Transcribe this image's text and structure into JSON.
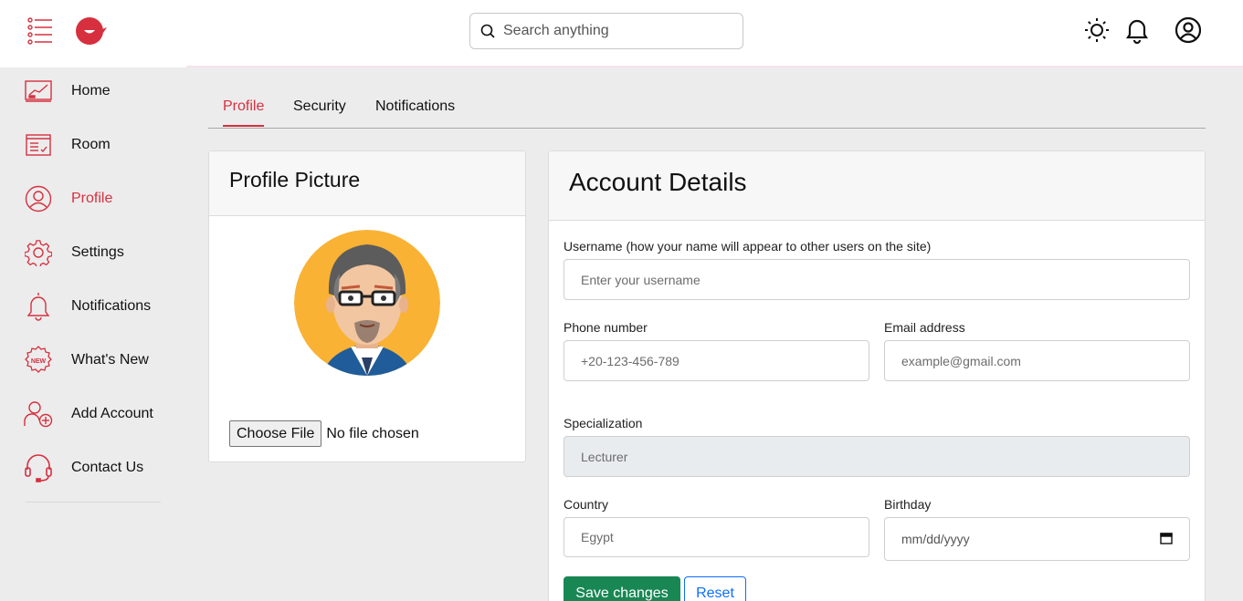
{
  "sidebar": {
    "items": [
      {
        "label": "Home",
        "icon": "chart-monitor-icon"
      },
      {
        "label": "Room",
        "icon": "checklist-board-icon"
      },
      {
        "label": "Profile",
        "icon": "user-circle-icon"
      },
      {
        "label": "Settings",
        "icon": "gear-icon"
      },
      {
        "label": "Notifications",
        "icon": "bell-icon"
      },
      {
        "label": "What's New",
        "icon": "new-badge-icon"
      },
      {
        "label": "Add Account",
        "icon": "add-user-icon"
      },
      {
        "label": "Contact Us",
        "icon": "headset-icon"
      }
    ],
    "active_index": 2
  },
  "search": {
    "placeholder": "Search anything"
  },
  "tabs": [
    {
      "label": "Profile"
    },
    {
      "label": "Security"
    },
    {
      "label": "Notifications"
    }
  ],
  "profile_picture": {
    "title": "Profile Picture",
    "choose_file_label": "Choose File",
    "file_status": "No file chosen"
  },
  "account_details": {
    "title": "Account Details",
    "username": {
      "label": "Username (how your name will appear to other users on the site)",
      "placeholder": "Enter your username"
    },
    "phone": {
      "label": "Phone number",
      "placeholder": "+20-123-456-789"
    },
    "email": {
      "label": "Email address",
      "placeholder": "example@gmail.com"
    },
    "specialization": {
      "label": "Specialization",
      "placeholder": "Lecturer"
    },
    "country": {
      "label": "Country",
      "placeholder": "Egypt"
    },
    "birthday": {
      "label": "Birthday",
      "placeholder": "mm/dd/yyyy"
    },
    "save_label": "Save changes",
    "reset_label": "Reset"
  },
  "colors": {
    "accent": "#d6303f",
    "save": "#198754",
    "reset": "#0d6efd"
  }
}
